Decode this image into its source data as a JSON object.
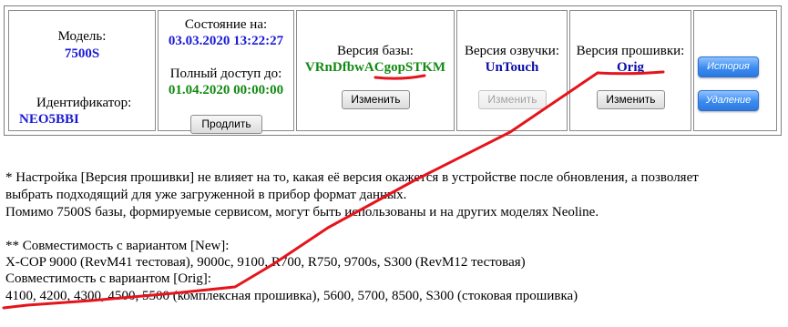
{
  "model": {
    "label": "Модель:",
    "value": "7500S"
  },
  "identifier": {
    "label": "Идентификатор:",
    "value": "NEO5BBI"
  },
  "state": {
    "label": "Состояние на:",
    "datetime": "03.03.2020 13:22:27",
    "access_label": "Полный доступ до:",
    "access_until": "01.04.2020 00:00:00",
    "extend_button": "Продлить"
  },
  "base": {
    "label": "Версия базы:",
    "value": "VRnDfbwACgopSTKM",
    "change_button": "Изменить"
  },
  "voice": {
    "label": "Версия озвучки:",
    "value": "UnTouch",
    "change_button": "Изменить"
  },
  "firmware": {
    "label": "Версия прошивки:",
    "value": "Orig",
    "change_button": "Изменить"
  },
  "side_buttons": {
    "history": "История",
    "delete": "Удаление"
  },
  "notes": [
    "* Настройка [Версия прошивки] не влияет на то, какая её версия окажется в устройстве после обновления, а позволяет",
    "выбрать подходящий для уже загруженной в прибор формат данных.",
    "Помимо 7500S базы, формируемые сервисом, могут быть использованы и на других моделях Neoline.",
    "** Совместимость с вариантом [New]:",
    "X-COP 9000 (RevM41 тестовая), 9000c, 9100, R700, R750, 9700s, S300 (RevM12 тестовая)",
    "Совместимость с вариантом [Orig]:",
    "4100, 4200, 4300, 4500, 5500 (комплексная прошивка), 5600, 5700, 8500, S300 (стоковая прошивка)"
  ],
  "colors": {
    "annotation": "#e5141c",
    "link_blue": "#1a1ad6",
    "value_green": "#138a13",
    "button_blue": "#3a8cf0"
  }
}
